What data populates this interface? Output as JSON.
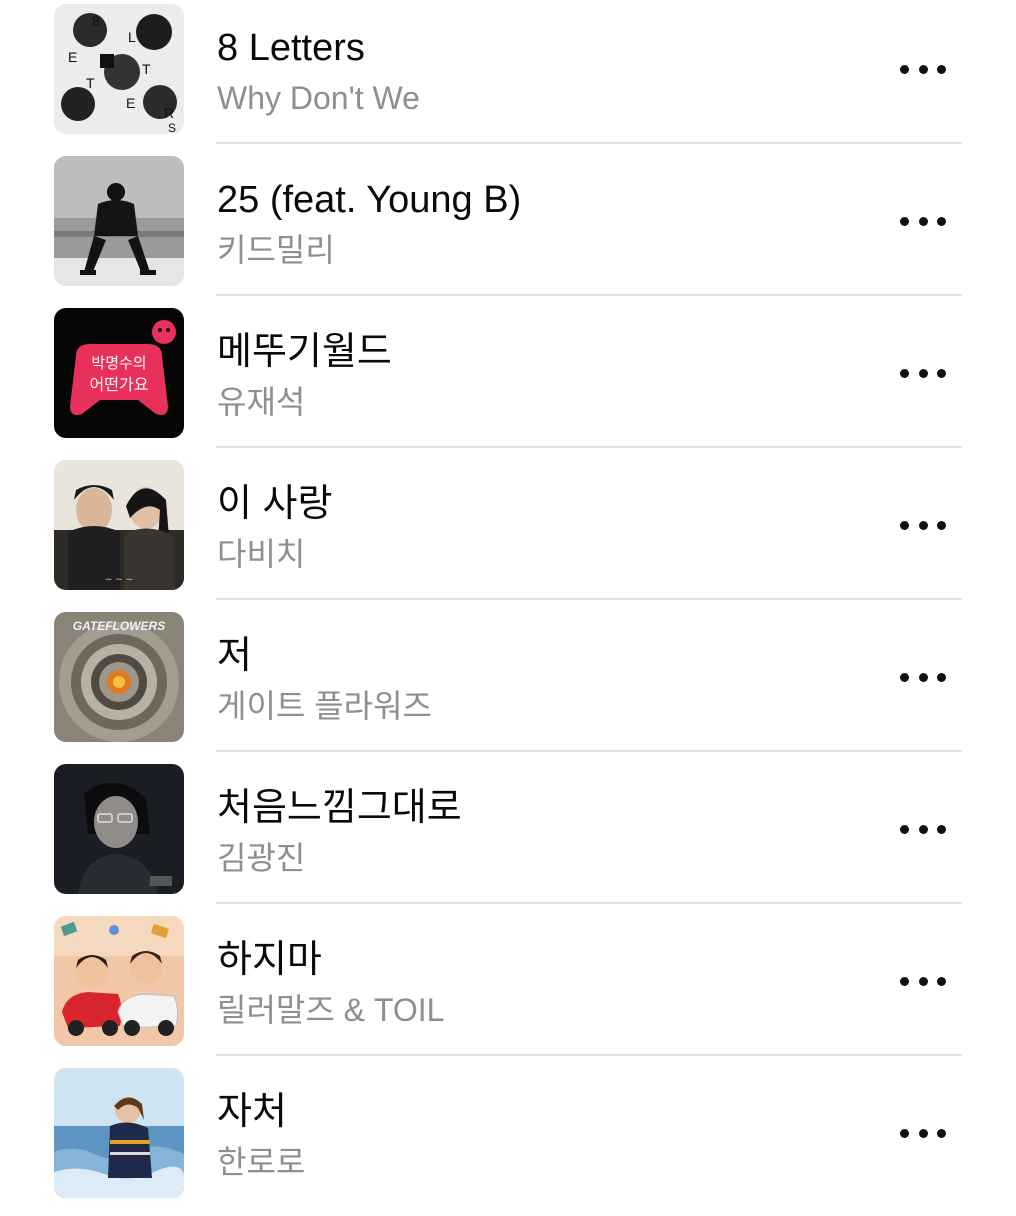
{
  "songs": [
    {
      "title": "8 Letters",
      "artist": "Why Don't We",
      "art": "8-letters-cover"
    },
    {
      "title": "25 (feat. Young B)",
      "artist": "키드밀리",
      "art": "25-cover"
    },
    {
      "title": "메뚜기월드",
      "artist": "유재석",
      "art": "park-myungsoo-cover"
    },
    {
      "title": "이 사랑",
      "artist": "다비치",
      "art": "this-love-cover"
    },
    {
      "title": "저",
      "artist": "게이트 플라워즈",
      "art": "gateflowers-cover"
    },
    {
      "title": "처음느낌그대로",
      "artist": "김광진",
      "art": "kim-kwangjin-cover"
    },
    {
      "title": "하지마",
      "artist": "릴러말즈 & TOIL",
      "art": "cartoon-cars-cover"
    },
    {
      "title": "자처",
      "artist": "한로로",
      "art": "ocean-portrait-cover"
    }
  ],
  "cover_text": {
    "letters_art": [
      "8",
      "L",
      "E",
      "T",
      "T",
      "E",
      "R",
      "S"
    ],
    "gateflowers_art": "GATEFLOWERS",
    "park_art_line1": "박명수의",
    "park_art_line2": "어떤가요"
  },
  "more_icon": "ellipsis-icon"
}
